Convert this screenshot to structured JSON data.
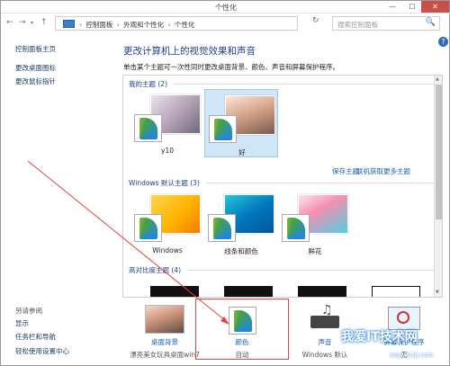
{
  "window": {
    "title": "个性化",
    "minimize": "—",
    "maximize": "☐",
    "close": "✕"
  },
  "nav": {
    "back": "←",
    "forward": "→",
    "dropdown": "▾",
    "up": "↑",
    "crumbs": [
      "控制面板",
      "外观和个性化",
      "个性化"
    ],
    "sep": "›",
    "refresh": "↻",
    "search_placeholder": "搜索控制面板",
    "search_icon": "🔍"
  },
  "sidebar": {
    "items": [
      "控制面板主页",
      "更改桌面图标",
      "更改鼠标指针"
    ],
    "see_also": "另请参阅",
    "links": [
      "显示",
      "任务栏和导航",
      "轻松使用设置中心"
    ]
  },
  "main": {
    "help": "?",
    "heading": "更改计算机上的视觉效果和声音",
    "subtitle": "单击某个主题可一次性同时更改桌面背景、颜色、声音和屏幕保护程序。",
    "my_themes": {
      "title": "我的主题 (2)",
      "items": [
        "y10",
        "好"
      ],
      "save": "保存主题",
      "online": "联机获取更多主题"
    },
    "default_themes": {
      "title": "Windows 默认主题 (3)",
      "items": [
        "Windows",
        "线条和颜色",
        "鲜花"
      ]
    },
    "high_contrast": {
      "title": "高对比度主题 (4)"
    }
  },
  "bottom": {
    "items": [
      {
        "label": "桌面背景",
        "sub": "漂亮美女玩具桌面win7"
      },
      {
        "label": "颜色",
        "sub": "自动"
      },
      {
        "label": "声音",
        "sub": "Windows 默认"
      },
      {
        "label": "屏幕保护程序",
        "sub": "无"
      }
    ]
  },
  "watermark": {
    "text": "我爱IT技术网",
    "sub": "www.52ij.com"
  },
  "colors": {
    "accent": "#1e3f8a",
    "link": "#1a5fb4",
    "selected": "#cfe6f7",
    "highlight": "#e5443b"
  }
}
